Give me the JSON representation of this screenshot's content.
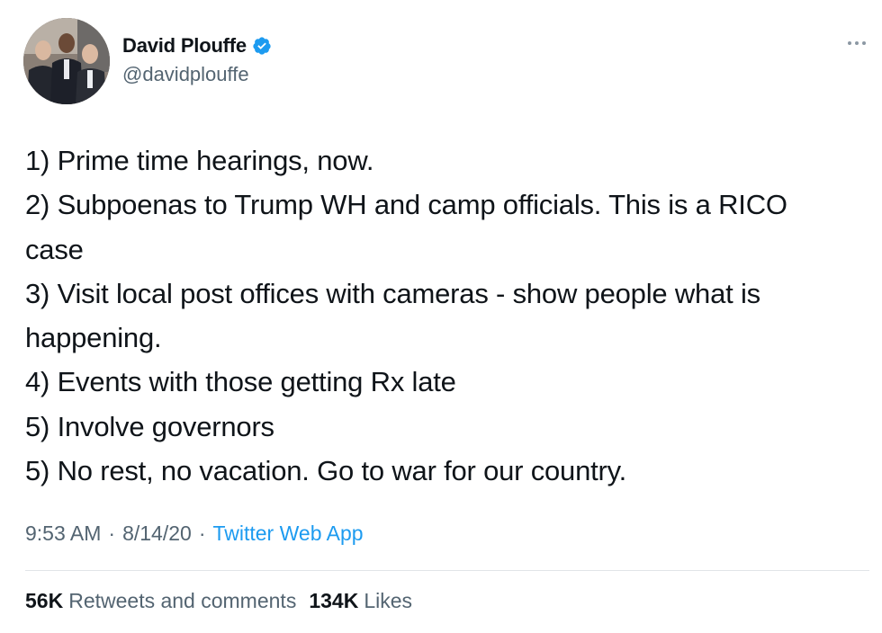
{
  "author": {
    "display_name": "David Plouffe",
    "handle": "@davidplouffe",
    "verified": true,
    "avatar": "profile-photo"
  },
  "tweet": {
    "lines": [
      "1) Prime time hearings, now.",
      "2) Subpoenas to Trump WH and camp officials. This is a RICO",
      "case",
      "3) Visit local post offices with cameras - show people what is",
      "happening.",
      "4) Events with those getting Rx late",
      "5) Involve governors",
      "5) No rest, no vacation. Go to war for our country."
    ]
  },
  "meta": {
    "time": "9:53 AM",
    "separator": "·",
    "date": "8/14/20",
    "app": "Twitter Web App"
  },
  "stats": {
    "retweets_count": "56K",
    "retweets_label": "Retweets and comments",
    "likes_count": "134K",
    "likes_label": "Likes"
  },
  "colors": {
    "text": "#0f1419",
    "secondary": "#536471",
    "link": "#1d9bf0",
    "verified": "#1d9bf0",
    "divider": "#e1e5e8"
  },
  "icons": {
    "verified": "verified-badge-icon",
    "more": "more-options-icon"
  }
}
